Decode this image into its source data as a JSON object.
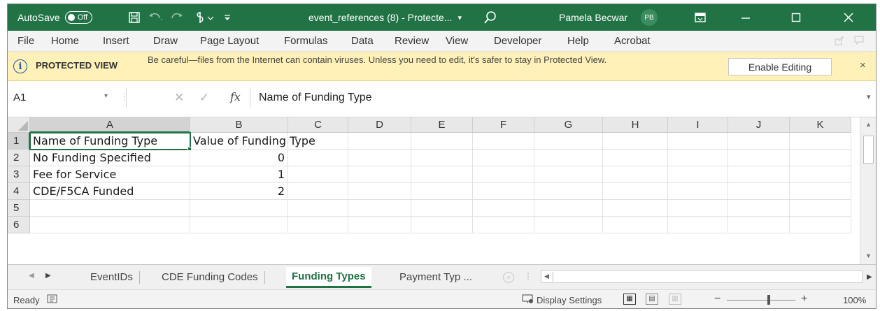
{
  "titlebar": {
    "autosave_label": "AutoSave",
    "autosave_state": "Off",
    "file_title": "event_references (8)  -  Protecte...",
    "title_dropdown": "▾",
    "user_name": "Pamela Becwar",
    "user_initials": "PB",
    "icons": [
      "save-icon",
      "undo-icon",
      "redo-icon",
      "sensitivity-icon",
      "customize-qat-icon",
      "search-icon",
      "ribbon-display-options-icon",
      "minimize-icon",
      "maximize-icon",
      "close-icon"
    ]
  },
  "ribbon": {
    "tabs": [
      "File",
      "Home",
      "Insert",
      "Draw",
      "Page Layout",
      "Formulas",
      "Data",
      "Review",
      "View",
      "Developer",
      "Help",
      "Acrobat"
    ]
  },
  "protected_view": {
    "title": "PROTECTED VIEW",
    "message": "Be careful—files from the Internet can contain viruses. Unless you need to edit, it's safer to stay in Protected View.",
    "button": "Enable Editing",
    "close": "×"
  },
  "formula_bar": {
    "name_box": "A1",
    "fx": "fx",
    "content": "Name of Funding Type"
  },
  "grid": {
    "columns": [
      "A",
      "B",
      "C",
      "D",
      "E",
      "F",
      "G",
      "H",
      "I",
      "J",
      "K"
    ],
    "rows": [
      "1",
      "2",
      "3",
      "4",
      "5",
      "6"
    ],
    "cells": [
      [
        "Name of Funding Type",
        "Value of Funding Type"
      ],
      [
        "No Funding Specified",
        "0"
      ],
      [
        "Fee for Service",
        "1"
      ],
      [
        "CDE/F5CA Funded",
        "2"
      ],
      [
        "",
        ""
      ],
      [
        "",
        ""
      ]
    ],
    "active_cell": "A1"
  },
  "sheets": {
    "tabs": [
      "EventIDs",
      "CDE Funding Codes",
      "Funding Types",
      "Payment Typ ..."
    ],
    "active": "Funding Types"
  },
  "status_bar": {
    "mode": "Ready",
    "display_settings": "Display Settings",
    "zoom": "100%",
    "zoom_minus": "−",
    "zoom_plus": "+"
  },
  "colors": {
    "accent": "#217346",
    "protected_bg": "#fff1b8"
  }
}
